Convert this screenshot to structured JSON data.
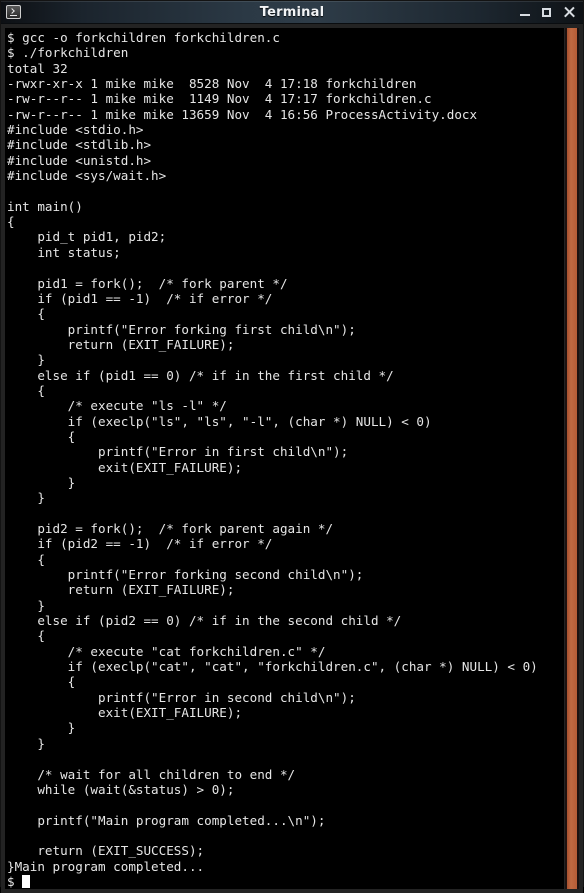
{
  "window": {
    "title": "Terminal",
    "icon": "terminal-icon",
    "controls": [
      {
        "name": "minimize-button",
        "glyph": "_"
      },
      {
        "name": "maximize-button",
        "glyph": "□"
      },
      {
        "name": "close-button",
        "glyph": "×"
      }
    ]
  },
  "terminal": {
    "background_color": "#000000",
    "foreground_color": "#e6e6e6",
    "scrollbar_color": "#c0643c",
    "titlebar_color": "#2e3c48",
    "prompt": "$",
    "cursor": "block",
    "commands": [
      "gcc -o forkchildren forkchildren.c",
      "./forkchildren"
    ],
    "ls_output": {
      "total": "total 32",
      "entries": [
        {
          "permissions": "-rwxr-xr-x",
          "links": "1",
          "owner": "mike",
          "group": "mike",
          "size": "8528",
          "month": "Nov",
          "day": "4",
          "time": "17:18",
          "name": "forkchildren"
        },
        {
          "permissions": "-rw-r--r--",
          "links": "1",
          "owner": "mike",
          "group": "mike",
          "size": "1149",
          "month": "Nov",
          "day": "4",
          "time": "17:17",
          "name": "forkchildren.c"
        },
        {
          "permissions": "-rw-r--r--",
          "links": "1",
          "owner": "mike",
          "group": "mike",
          "size": "13659",
          "month": "Nov",
          "day": "4",
          "time": "16:56",
          "name": "ProcessActivity.docx"
        }
      ]
    },
    "final_output": "Main program completed...",
    "screen_text": "$ gcc -o forkchildren forkchildren.c\n$ ./forkchildren\ntotal 32\n-rwxr-xr-x 1 mike mike  8528 Nov  4 17:18 forkchildren\n-rw-r--r-- 1 mike mike  1149 Nov  4 17:17 forkchildren.c\n-rw-r--r-- 1 mike mike 13659 Nov  4 16:56 ProcessActivity.docx\n#include <stdio.h>\n#include <stdlib.h>\n#include <unistd.h>\n#include <sys/wait.h>\n\nint main()\n{\n    pid_t pid1, pid2;\n    int status;\n\n    pid1 = fork();  /* fork parent */\n    if (pid1 == -1)  /* if error */\n    {\n        printf(\"Error forking first child\\n\");\n        return (EXIT_FAILURE);\n    }\n    else if (pid1 == 0) /* if in the first child */\n    {\n        /* execute \"ls -l\" */\n        if (execlp(\"ls\", \"ls\", \"-l\", (char *) NULL) < 0)\n        {\n            printf(\"Error in first child\\n\");\n            exit(EXIT_FAILURE);\n        }\n    }\n\n    pid2 = fork();  /* fork parent again */\n    if (pid2 == -1)  /* if error */\n    {\n        printf(\"Error forking second child\\n\");\n        return (EXIT_FAILURE);\n    }\n    else if (pid2 == 0) /* if in the second child */\n    {\n        /* execute \"cat forkchildren.c\" */\n        if (execlp(\"cat\", \"cat\", \"forkchildren.c\", (char *) NULL) < 0)\n        {\n            printf(\"Error in second child\\n\");\n            exit(EXIT_FAILURE);\n        }\n    }\n\n    /* wait for all children to end */\n    while (wait(&status) > 0);\n\n    printf(\"Main program completed...\\n\");\n\n    return (EXIT_SUCCESS);\n}Main program completed...",
    "prompt_line": "$ "
  }
}
